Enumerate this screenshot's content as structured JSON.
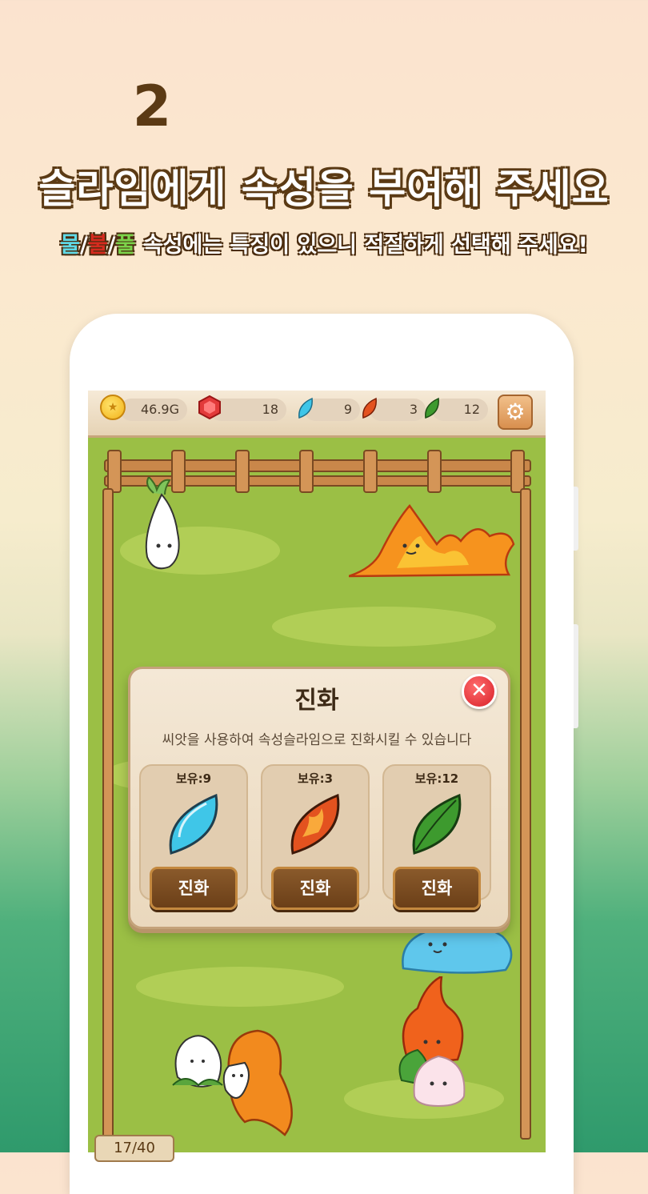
{
  "header": {
    "step_number": "2",
    "title": "슬라임에게 속성을 부여해 주세요",
    "subtitle_water": "물",
    "subtitle_sep1": "/",
    "subtitle_fire": "불",
    "subtitle_sep2": "/",
    "subtitle_grass": "풀",
    "subtitle_rest": " 속성에는 특징이 있으니 적절하게 선택해 주세요!"
  },
  "topbar": {
    "gold": "46.9G",
    "gems": "18",
    "water_seeds": "9",
    "fire_seeds": "3",
    "grass_seeds": "12",
    "coin_icon": "coin-icon",
    "gem_icon": "ruby-icon",
    "settings_icon": "gear-icon"
  },
  "modal": {
    "title": "진화",
    "close_icon": "close-icon",
    "description": "씨앗을 사용하여 속성슬라임으로  진화시킬 수 있습니다",
    "cards": [
      {
        "have": "보유:9",
        "button": "진화",
        "seed": "water-seed-icon",
        "color": "#3fc6e8"
      },
      {
        "have": "보유:3",
        "button": "진화",
        "seed": "fire-seed-icon",
        "color": "#e3521f"
      },
      {
        "have": "보유:12",
        "button": "진화",
        "seed": "grass-seed-icon",
        "color": "#3d9a2e"
      }
    ]
  },
  "field": {
    "slime_count": "17/40"
  },
  "colors": {
    "brown": "#5b3a14",
    "water": "#5fd9e6",
    "fire": "#d62b1f",
    "grass": "#7bd34a"
  }
}
